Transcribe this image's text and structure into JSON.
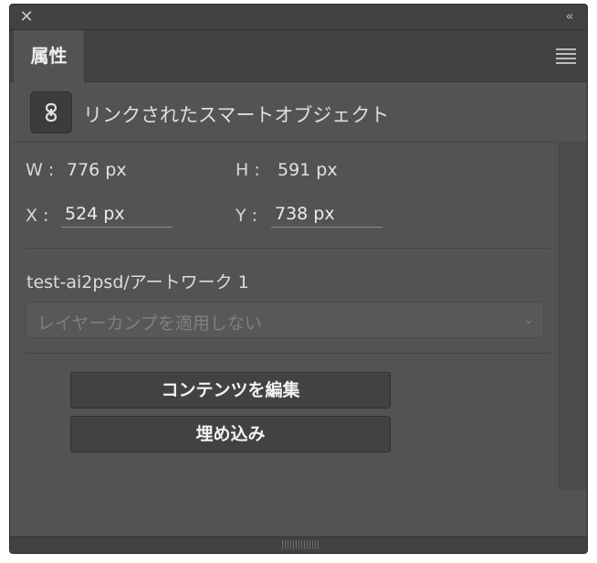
{
  "window": {
    "close_glyph": "✕",
    "collapse_glyph": "‹‹"
  },
  "tab": {
    "label": "属性"
  },
  "smart_object": {
    "type_label": "リンクされたスマートオブジェクト"
  },
  "transform": {
    "w_label": "W :",
    "w_value": "776 px",
    "h_label": "H :",
    "h_value": "591 px",
    "x_label": "X :",
    "x_value": "524 px",
    "y_label": "Y :",
    "y_value": "738 px"
  },
  "layer": {
    "name": "test-ai2psd/アートワーク 1",
    "comp_select_value": "レイヤーカンプを適用しない"
  },
  "buttons": {
    "edit_contents": "コンテンツを編集",
    "embed": "埋め込み"
  },
  "colors": {
    "panel_bg": "#535353",
    "header_bg": "#424242",
    "text": "#d6d6d6"
  }
}
